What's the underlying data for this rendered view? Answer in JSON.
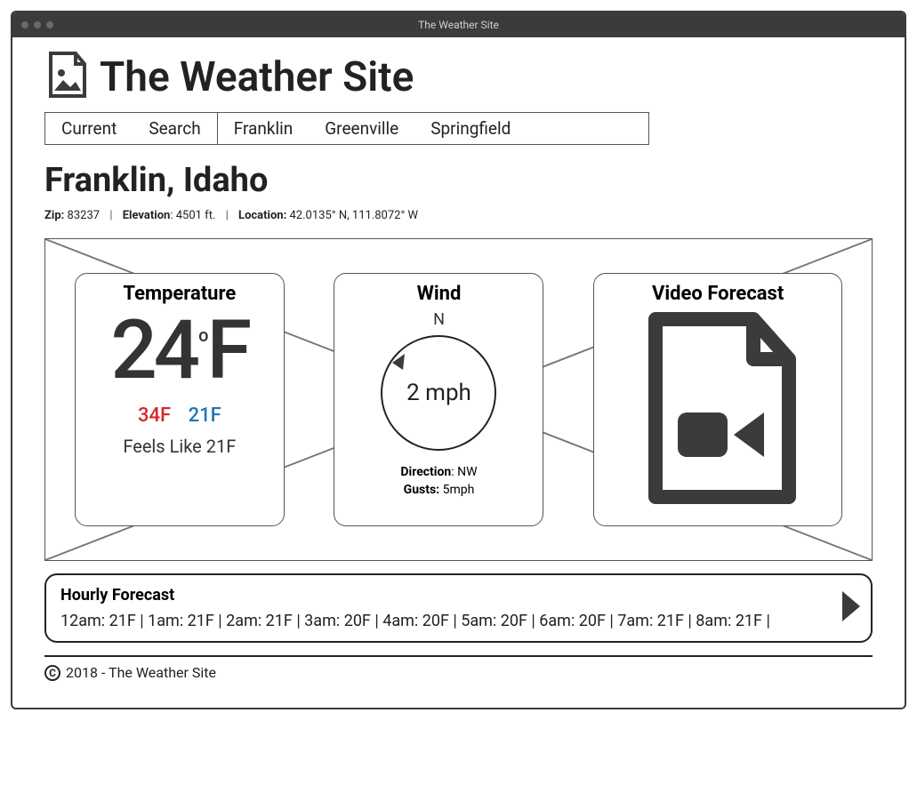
{
  "window": {
    "title": "The Weather Site"
  },
  "header": {
    "site_title": "The Weather Site"
  },
  "nav": {
    "items": [
      {
        "label": "Current"
      },
      {
        "label": "Search"
      },
      {
        "label": "Franklin"
      },
      {
        "label": "Greenville"
      },
      {
        "label": "Springfield"
      }
    ]
  },
  "page": {
    "title": "Franklin, Idaho",
    "meta": {
      "zip_label": "Zip:",
      "zip": "83237",
      "elev_label": "Elevation",
      "elev": "4501 ft.",
      "loc_label": "Location:",
      "loc": "42.0135° N, 111.8072° W"
    }
  },
  "cards": {
    "temperature": {
      "title": "Temperature",
      "value": "24",
      "unit": "F",
      "high": "34F",
      "low": "21F",
      "feels_like": "Feels Like 21F"
    },
    "wind": {
      "title": "Wind",
      "north_label": "N",
      "speed": "2 mph",
      "direction_label": "Direction",
      "direction": "NW",
      "gusts_label": "Gusts:",
      "gusts": "5mph"
    },
    "video": {
      "title": "Video Forecast"
    }
  },
  "hourly": {
    "title": "Hourly Forecast",
    "row": "12am: 21F  |  1am: 21F  |   2am: 21F | 3am: 20F  |   4am: 20F  |   5am: 20F  |   6am: 20F  |   7am:  21F  |   8am:  21F  |"
  },
  "footer": {
    "text": "2018 - The Weather Site"
  }
}
